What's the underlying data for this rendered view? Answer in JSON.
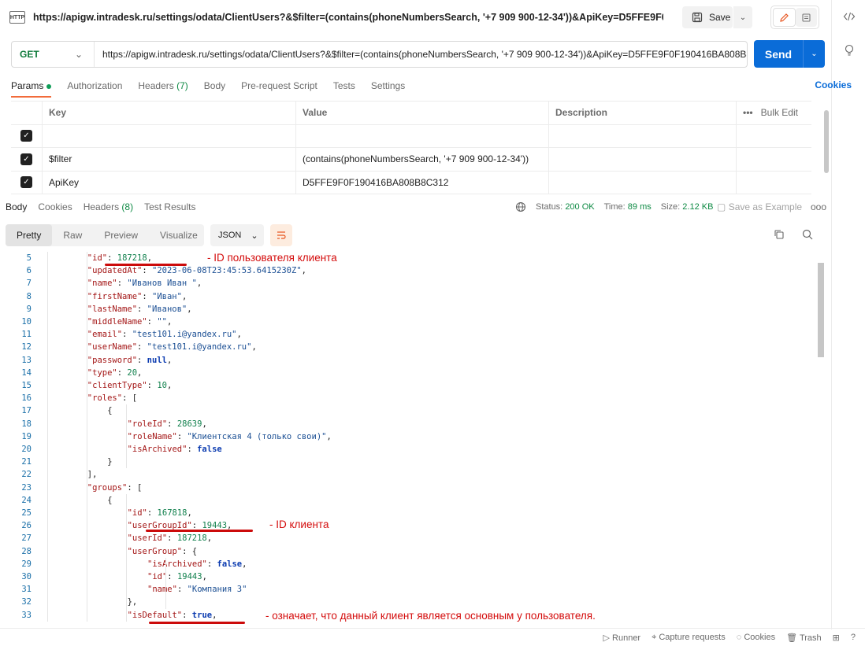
{
  "title_bar": {
    "badge": "HTTP",
    "title": "https://apigw.intradesk.ru/settings/odata/ClientUsers?&$filter=(contains(phoneNumbersSearch, '+7 909 900-12-34'))&ApiKey=D5FFE9F0F190416BA...",
    "save_label": "Save"
  },
  "request": {
    "method": "GET",
    "url": "https://apigw.intradesk.ru/settings/odata/ClientUsers?&$filter=(contains(phoneNumbersSearch, '+7 909 900-12-34'))&ApiKey=D5FFE9F0F190416BA808B8C3...",
    "send_label": "Send"
  },
  "request_tabs": {
    "params": "Params",
    "authorization": "Authorization",
    "headers": "Headers",
    "headers_count": "(7)",
    "body": "Body",
    "pre_request": "Pre-request Script",
    "tests": "Tests",
    "settings": "Settings",
    "cookies": "Cookies"
  },
  "params_table": {
    "headers": {
      "key": "Key",
      "value": "Value",
      "description": "Description",
      "more": "•••",
      "bulk_edit": "Bulk Edit"
    },
    "rows": [
      {
        "key": "",
        "value": "",
        "description": ""
      },
      {
        "key": "$filter",
        "value": "(contains(phoneNumbersSearch, '+7 909 900-12-34'))",
        "description": ""
      },
      {
        "key": "ApiKey",
        "value": "D5FFE9F0F190416BA808B8C312",
        "description": ""
      }
    ]
  },
  "response_tabs": {
    "body": "Body",
    "cookies": "Cookies",
    "headers": "Headers",
    "headers_count": "(8)",
    "test_results": "Test Results"
  },
  "response_status": {
    "status_label": "Status:",
    "status": "200 OK",
    "time_label": "Time:",
    "time": "89 ms",
    "size_label": "Size:",
    "size": "2.12 KB",
    "save_example": "Save as Example",
    "more": "ooo"
  },
  "view_tabs": {
    "pretty": "Pretty",
    "raw": "Raw",
    "preview": "Preview",
    "visualize": "Visualize",
    "format": "JSON"
  },
  "code_lines": [
    {
      "n": "5",
      "indent": 8,
      "parts": [
        [
          "k",
          "\"id\""
        ],
        [
          "p",
          ": "
        ],
        [
          "n",
          "187218"
        ],
        [
          "p",
          ","
        ]
      ]
    },
    {
      "n": "6",
      "indent": 8,
      "parts": [
        [
          "k",
          "\"updatedAt\""
        ],
        [
          "p",
          ": "
        ],
        [
          "s",
          "\"2023-06-08T23:45:53.6415230Z\""
        ],
        [
          "p",
          ","
        ]
      ]
    },
    {
      "n": "7",
      "indent": 8,
      "parts": [
        [
          "k",
          "\"name\""
        ],
        [
          "p",
          ": "
        ],
        [
          "s",
          "\"Иванов Иван \""
        ],
        [
          "p",
          ","
        ]
      ]
    },
    {
      "n": "8",
      "indent": 8,
      "parts": [
        [
          "k",
          "\"firstName\""
        ],
        [
          "p",
          ": "
        ],
        [
          "s",
          "\"Иван\""
        ],
        [
          "p",
          ","
        ]
      ]
    },
    {
      "n": "9",
      "indent": 8,
      "parts": [
        [
          "k",
          "\"lastName\""
        ],
        [
          "p",
          ": "
        ],
        [
          "s",
          "\"Иванов\""
        ],
        [
          "p",
          ","
        ]
      ]
    },
    {
      "n": "10",
      "indent": 8,
      "parts": [
        [
          "k",
          "\"middleName\""
        ],
        [
          "p",
          ": "
        ],
        [
          "s",
          "\"\""
        ],
        [
          "p",
          ","
        ]
      ]
    },
    {
      "n": "11",
      "indent": 8,
      "parts": [
        [
          "k",
          "\"email\""
        ],
        [
          "p",
          ": "
        ],
        [
          "s",
          "\"test101.i@yandex.ru\""
        ],
        [
          "p",
          ","
        ]
      ]
    },
    {
      "n": "12",
      "indent": 8,
      "parts": [
        [
          "k",
          "\"userName\""
        ],
        [
          "p",
          ": "
        ],
        [
          "s",
          "\"test101.i@yandex.ru\""
        ],
        [
          "p",
          ","
        ]
      ]
    },
    {
      "n": "13",
      "indent": 8,
      "parts": [
        [
          "k",
          "\"password\""
        ],
        [
          "p",
          ": "
        ],
        [
          "b",
          "null"
        ],
        [
          "p",
          ","
        ]
      ]
    },
    {
      "n": "14",
      "indent": 8,
      "parts": [
        [
          "k",
          "\"type\""
        ],
        [
          "p",
          ": "
        ],
        [
          "n",
          "20"
        ],
        [
          "p",
          ","
        ]
      ]
    },
    {
      "n": "15",
      "indent": 8,
      "parts": [
        [
          "k",
          "\"clientType\""
        ],
        [
          "p",
          ": "
        ],
        [
          "n",
          "10"
        ],
        [
          "p",
          ","
        ]
      ]
    },
    {
      "n": "16",
      "indent": 8,
      "parts": [
        [
          "k",
          "\"roles\""
        ],
        [
          "p",
          ": ["
        ]
      ]
    },
    {
      "n": "17",
      "indent": 12,
      "parts": [
        [
          "p",
          "{"
        ]
      ]
    },
    {
      "n": "18",
      "indent": 16,
      "parts": [
        [
          "k",
          "\"roleId\""
        ],
        [
          "p",
          ": "
        ],
        [
          "n",
          "28639"
        ],
        [
          "p",
          ","
        ]
      ]
    },
    {
      "n": "19",
      "indent": 16,
      "parts": [
        [
          "k",
          "\"roleName\""
        ],
        [
          "p",
          ": "
        ],
        [
          "s",
          "\"Клиентская 4 (только свои)\""
        ],
        [
          "p",
          ","
        ]
      ]
    },
    {
      "n": "20",
      "indent": 16,
      "parts": [
        [
          "k",
          "\"isArchived\""
        ],
        [
          "p",
          ": "
        ],
        [
          "b",
          "false"
        ]
      ]
    },
    {
      "n": "21",
      "indent": 12,
      "parts": [
        [
          "p",
          "}"
        ]
      ]
    },
    {
      "n": "22",
      "indent": 8,
      "parts": [
        [
          "p",
          "],"
        ]
      ]
    },
    {
      "n": "23",
      "indent": 8,
      "parts": [
        [
          "k",
          "\"groups\""
        ],
        [
          "p",
          ": ["
        ]
      ]
    },
    {
      "n": "24",
      "indent": 12,
      "parts": [
        [
          "p",
          "{"
        ]
      ]
    },
    {
      "n": "25",
      "indent": 16,
      "parts": [
        [
          "k",
          "\"id\""
        ],
        [
          "p",
          ": "
        ],
        [
          "n",
          "167818"
        ],
        [
          "p",
          ","
        ]
      ]
    },
    {
      "n": "26",
      "indent": 16,
      "parts": [
        [
          "k",
          "\"userGroupId\""
        ],
        [
          "p",
          ": "
        ],
        [
          "n",
          "19443"
        ],
        [
          "p",
          ","
        ]
      ]
    },
    {
      "n": "27",
      "indent": 16,
      "parts": [
        [
          "k",
          "\"userId\""
        ],
        [
          "p",
          ": "
        ],
        [
          "n",
          "187218"
        ],
        [
          "p",
          ","
        ]
      ]
    },
    {
      "n": "28",
      "indent": 16,
      "parts": [
        [
          "k",
          "\"userGroup\""
        ],
        [
          "p",
          ": {"
        ]
      ]
    },
    {
      "n": "29",
      "indent": 20,
      "parts": [
        [
          "k",
          "\"isArchived\""
        ],
        [
          "p",
          ": "
        ],
        [
          "b",
          "false"
        ],
        [
          "p",
          ","
        ]
      ]
    },
    {
      "n": "30",
      "indent": 20,
      "parts": [
        [
          "k",
          "\"id\""
        ],
        [
          "p",
          ": "
        ],
        [
          "n",
          "19443"
        ],
        [
          "p",
          ","
        ]
      ]
    },
    {
      "n": "31",
      "indent": 20,
      "parts": [
        [
          "k",
          "\"name\""
        ],
        [
          "p",
          ": "
        ],
        [
          "s",
          "\"Компания 3\""
        ]
      ]
    },
    {
      "n": "32",
      "indent": 16,
      "parts": [
        [
          "p",
          "},"
        ]
      ]
    },
    {
      "n": "33",
      "indent": 16,
      "parts": [
        [
          "k",
          "\"isDefault\""
        ],
        [
          "p",
          ": "
        ],
        [
          "b",
          "true"
        ],
        [
          "p",
          ","
        ]
      ]
    }
  ],
  "annotations": {
    "user_id": "- ID пользователя клиента",
    "client_id": "- ID клиента",
    "is_default": "- означает, что данный клиент является основным у пользователя."
  },
  "footer": {
    "runner": "Runner",
    "capture": "Capture requests",
    "cookies": "Cookies",
    "trash": "Trash"
  },
  "colors": {
    "accent": "#0a6cd8",
    "tab_underline": "#f26b3a",
    "annotation_red": "#d40c0c",
    "status_green": "#0e8a44"
  }
}
